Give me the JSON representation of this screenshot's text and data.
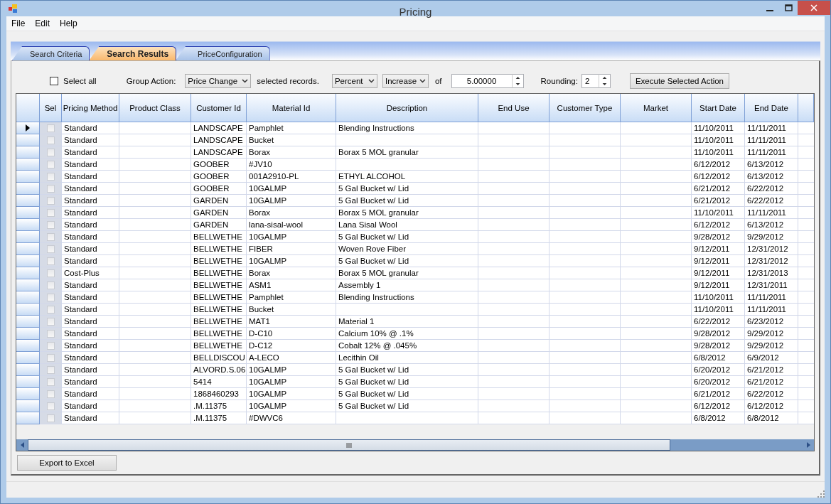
{
  "window": {
    "title": "Pricing"
  },
  "menu": [
    "File",
    "Edit",
    "Help"
  ],
  "tabs": [
    {
      "label": "Search Criteria",
      "selected": false
    },
    {
      "label": "Search Results",
      "selected": true
    },
    {
      "label": "PriceConfiguration",
      "selected": false
    }
  ],
  "toolbar": {
    "select_all": {
      "label": "Select all",
      "checked": false
    },
    "group_action_label": "Group Action:",
    "group_action": "Price Change",
    "selected_records_label": "selected records.",
    "mode": "Percent",
    "direction": "Increase",
    "of_label": "of",
    "amount": "5.00000",
    "rounding_label": "Rounding:",
    "rounding": "2",
    "execute_button": "Execute Selected Action"
  },
  "table": {
    "columns": [
      "Sel",
      "Pricing Method",
      "Product Class",
      "Customer Id",
      "Material Id",
      "Description",
      "End Use",
      "Customer Type",
      "Market",
      "Start Date",
      "End Date"
    ],
    "rows": [
      {
        "current": true,
        "checked": false,
        "pricing_method": "Standard",
        "customer_id": "LANDSCAPE",
        "material_id": "Pamphlet",
        "description": "Blending Instructions",
        "start_date": "11/10/2011",
        "end_date": "11/11/2011"
      },
      {
        "current": false,
        "checked": false,
        "pricing_method": "Standard",
        "customer_id": "LANDSCAPE",
        "material_id": "Bucket",
        "start_date": "11/10/2011",
        "end_date": "11/11/2011"
      },
      {
        "current": false,
        "checked": false,
        "pricing_method": "Standard",
        "customer_id": "LANDSCAPE",
        "material_id": "Borax",
        "description": "Borax 5 MOL granular",
        "start_date": "11/10/2011",
        "end_date": "11/11/2011"
      },
      {
        "current": false,
        "checked": false,
        "pricing_method": "Standard",
        "customer_id": "GOOBER",
        "material_id": "#JV10",
        "start_date": "6/12/2012",
        "end_date": "6/13/2012"
      },
      {
        "current": false,
        "checked": false,
        "pricing_method": "Standard",
        "customer_id": "GOOBER",
        "material_id": "001A2910-PL",
        "description": "ETHYL ALCOHOL",
        "start_date": "6/12/2012",
        "end_date": "6/13/2012"
      },
      {
        "current": false,
        "checked": false,
        "pricing_method": "Standard",
        "customer_id": "GOOBER",
        "material_id": "10GALMP",
        "description": "5 Gal Bucket w/ Lid",
        "start_date": "6/21/2012",
        "end_date": "6/22/2012"
      },
      {
        "current": false,
        "checked": false,
        "pricing_method": "Standard",
        "customer_id": "GARDEN",
        "material_id": "10GALMP",
        "description": "5 Gal Bucket w/ Lid",
        "start_date": "6/21/2012",
        "end_date": "6/22/2012"
      },
      {
        "current": false,
        "checked": false,
        "pricing_method": "Standard",
        "customer_id": "GARDEN",
        "material_id": "Borax",
        "description": "Borax 5 MOL granular",
        "start_date": "11/10/2011",
        "end_date": "11/11/2011"
      },
      {
        "current": false,
        "checked": false,
        "pricing_method": "Standard",
        "customer_id": "GARDEN",
        "material_id": "lana-sisal-wool",
        "description": "Lana Sisal Wool",
        "start_date": "6/12/2012",
        "end_date": "6/13/2012"
      },
      {
        "current": false,
        "checked": false,
        "pricing_method": "Standard",
        "customer_id": "BELLWETHE",
        "material_id": "10GALMP",
        "description": "5 Gal Bucket w/ Lid",
        "start_date": "9/28/2012",
        "end_date": "9/29/2012"
      },
      {
        "current": false,
        "checked": false,
        "pricing_method": "Standard",
        "customer_id": "BELLWETHE",
        "material_id": "FIBER",
        "description": "Woven Rove Fiber",
        "start_date": "9/12/2011",
        "end_date": "12/31/2012"
      },
      {
        "current": false,
        "checked": false,
        "pricing_method": "Standard",
        "customer_id": "BELLWETHE",
        "material_id": "10GALMP",
        "description": "5 Gal Bucket w/ Lid",
        "start_date": "9/12/2011",
        "end_date": "12/31/2012"
      },
      {
        "current": false,
        "checked": false,
        "pricing_method": "Cost-Plus",
        "customer_id": "BELLWETHE",
        "material_id": "Borax",
        "description": "Borax 5 MOL granular",
        "start_date": "9/12/2011",
        "end_date": "12/31/2013"
      },
      {
        "current": false,
        "checked": false,
        "pricing_method": "Standard",
        "customer_id": "BELLWETHE",
        "material_id": "ASM1",
        "description": "Assembly 1",
        "start_date": "9/12/2011",
        "end_date": "12/31/2011"
      },
      {
        "current": false,
        "checked": false,
        "pricing_method": "Standard",
        "customer_id": "BELLWETHE",
        "material_id": "Pamphlet",
        "description": "Blending Instructions",
        "start_date": "11/10/2011",
        "end_date": "11/11/2011"
      },
      {
        "current": false,
        "checked": false,
        "pricing_method": "Standard",
        "customer_id": "BELLWETHE",
        "material_id": "Bucket",
        "start_date": "11/10/2011",
        "end_date": "11/11/2011"
      },
      {
        "current": false,
        "checked": false,
        "pricing_method": "Standard",
        "customer_id": "BELLWETHE",
        "material_id": "MAT1",
        "description": "Material 1",
        "start_date": "6/22/2012",
        "end_date": "6/23/2012"
      },
      {
        "current": false,
        "checked": false,
        "pricing_method": "Standard",
        "customer_id": "BELLWETHE",
        "material_id": "D-C10",
        "description": "Calcium 10% @ .1%",
        "start_date": "9/28/2012",
        "end_date": "9/29/2012"
      },
      {
        "current": false,
        "checked": false,
        "pricing_method": "Standard",
        "customer_id": "BELLWETHE",
        "material_id": "D-C12",
        "description": "Cobalt 12% @ .045%",
        "start_date": "9/28/2012",
        "end_date": "9/29/2012"
      },
      {
        "current": false,
        "checked": false,
        "pricing_method": "Standard",
        "customer_id": "BELLDISCOU",
        "material_id": "A-LECO",
        "description": "Lecithin Oil",
        "start_date": "6/8/2012",
        "end_date": "6/9/2012"
      },
      {
        "current": false,
        "checked": false,
        "pricing_method": "Standard",
        "customer_id": "ALVORD.S.06",
        "material_id": "10GALMP",
        "description": "5 Gal Bucket w/ Lid",
        "start_date": "6/20/2012",
        "end_date": "6/21/2012"
      },
      {
        "current": false,
        "checked": false,
        "pricing_method": "Standard",
        "customer_id": "5414",
        "material_id": "10GALMP",
        "description": "5 Gal Bucket w/ Lid",
        "start_date": "6/20/2012",
        "end_date": "6/21/2012"
      },
      {
        "current": false,
        "checked": false,
        "pricing_method": "Standard",
        "customer_id": "1868460293",
        "material_id": "10GALMP",
        "description": "5 Gal Bucket w/ Lid",
        "start_date": "6/21/2012",
        "end_date": "6/22/2012"
      },
      {
        "current": false,
        "checked": false,
        "pricing_method": "Standard",
        "customer_id": ".M.11375",
        "material_id": "10GALMP",
        "description": "5 Gal Bucket w/ Lid",
        "start_date": "6/12/2012",
        "end_date": "6/12/2012"
      },
      {
        "current": false,
        "checked": false,
        "pricing_method": "Standard",
        "customer_id": ".M.11375",
        "material_id": "#DWVC6",
        "start_date": "6/8/2012",
        "end_date": "6/8/2012"
      }
    ]
  },
  "export_button": "Export to Excel"
}
